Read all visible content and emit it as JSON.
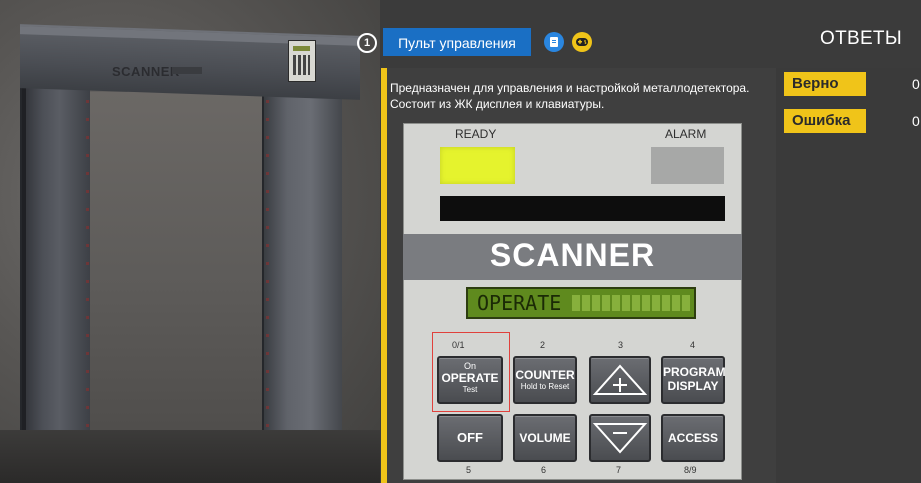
{
  "scene": {
    "logo": "SCANNER"
  },
  "header": {
    "step_number": "1",
    "tab_label": "Пульт управления",
    "answers_title": "ОТВЕТЫ"
  },
  "description": "Предназначен для управления и настройкой металлодетектора. Состоит из ЖК дисплея и клавиатуры.",
  "scores": {
    "correct_label": "Верно",
    "correct_value": "0",
    "error_label": "Ошибка",
    "error_value": "0"
  },
  "device": {
    "ready_label": "READY",
    "alarm_label": "ALARM",
    "brand": "SCANNER",
    "lcd_text": "OPERATE",
    "keys": [
      {
        "num": "0/1",
        "line1": "On",
        "line2": "OPERATE",
        "line3": "Test"
      },
      {
        "num": "2",
        "line1": "COUNTER",
        "line2": "Hold to Reset"
      },
      {
        "num": "3",
        "symbol": "plus"
      },
      {
        "num": "4",
        "line1": "PROGRAM",
        "line2": "DISPLAY"
      },
      {
        "num": "5",
        "line1": "OFF"
      },
      {
        "num": "6",
        "line1": "VOLUME"
      },
      {
        "num": "7",
        "symbol": "minus"
      },
      {
        "num": "8/9",
        "line1": "ACCESS"
      }
    ]
  },
  "colors": {
    "accent_yellow": "#f0c419",
    "tab_blue": "#1a6fc4",
    "ready_light": "#e5f32d",
    "highlight_red": "#e0413c"
  }
}
